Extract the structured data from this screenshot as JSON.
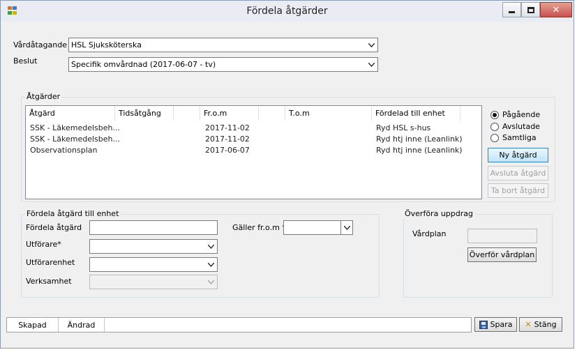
{
  "window": {
    "title": "Fördela åtgärder",
    "controls": {
      "minimize_icon": "minimize-icon",
      "maximize_icon": "maximize-icon",
      "close_icon": "close-icon"
    }
  },
  "header": {
    "vardatagande_label": "Vårdåtagande",
    "vardatagande_value": "HSL Sjuksköterska",
    "beslut_label": "Beslut",
    "beslut_value": "Specifik omvårdnad (2017-06-07 - tv)"
  },
  "atgarder": {
    "group_title": "Åtgärder",
    "columns": [
      "Åtgärd",
      "Tidsåtgång",
      "Fr.o.m",
      "T.o.m",
      "Fördelad till enhet"
    ],
    "rows": [
      {
        "atgard": "SSK - Läkemedelsbeh...",
        "tidsatgang": "",
        "from": "2017-11-02",
        "tom": "",
        "enhet": "Ryd HSL s-hus"
      },
      {
        "atgard": "SSK - Läkemedelsbeh...",
        "tidsatgang": "",
        "from": "2017-11-02",
        "tom": "",
        "enhet": "Ryd htj inne (Leanlink)"
      },
      {
        "atgard": "Observationsplan",
        "tidsatgang": "",
        "from": "2017-06-07",
        "tom": "",
        "enhet": "Ryd htj inne (Leanlink)"
      }
    ],
    "filter": {
      "options": [
        "Pågående",
        "Avslutade",
        "Samtliga"
      ],
      "selected": "Pågående"
    },
    "buttons": {
      "ny": "Ny åtgärd",
      "avsluta": "Avsluta åtgärd",
      "ta_bort": "Ta bort åtgärd"
    }
  },
  "fordela": {
    "group_title": "Fördela åtgärd till enhet",
    "fordela_atgard_label": "Fördela åtgärd",
    "fordela_atgard_value": "",
    "utforare_label": "Utförare*",
    "utforare_value": "",
    "utforarenhet_label": "Utförarenhet",
    "utforarenhet_value": "",
    "verksamhet_label": "Verksamhet",
    "verksamhet_value": "",
    "galler_from_label": "Gäller fr.o.m *",
    "galler_from_value": ""
  },
  "overfora": {
    "group_title": "Överföra uppdrag",
    "vardplan_label": "Vårdplan",
    "vardplan_value": "",
    "button": "Överför vårdplan"
  },
  "statusbar": {
    "skapad": "Skapad",
    "andrad": "Ändrad",
    "info": ""
  },
  "footer": {
    "spara": "Spara",
    "stang": "Stäng",
    "spara_icon": "save-disk-icon",
    "stang_icon": "close-x-icon"
  },
  "colors": {
    "window_bg": "#f0f0f0",
    "titlebar_bg": "#e9edf3",
    "primary_button": "#bee6fd",
    "close_button": "#c75050"
  }
}
